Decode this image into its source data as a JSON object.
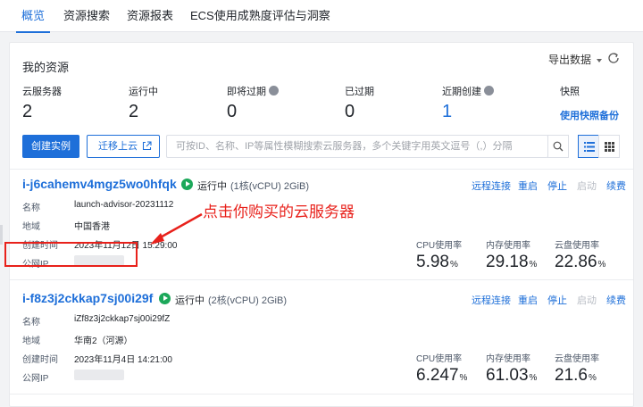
{
  "tabs": [
    {
      "label": "概览"
    },
    {
      "label": "资源搜索"
    },
    {
      "label": "资源报表"
    },
    {
      "label": "ECS使用成熟度评估与洞察"
    }
  ],
  "panel": {
    "title": "我的资源",
    "export_label": "导出数据"
  },
  "stats": [
    {
      "label": "云服务器",
      "value": "2"
    },
    {
      "label": "运行中",
      "value": "2"
    },
    {
      "label": "即将过期",
      "value": "0"
    },
    {
      "label": "已过期",
      "value": "0"
    },
    {
      "label": "近期创建",
      "value": "1"
    },
    {
      "label": "快照",
      "link": "使用快照备份"
    }
  ],
  "toolbar": {
    "create_label": "创建实例",
    "migrate_label": "迁移上云",
    "search_placeholder": "可按ID、名称、IP等属性模糊搜索云服务器，多个关键字用英文逗号（,）分隔"
  },
  "instances": [
    {
      "id": "i-j6cahemv4mgz5wo0hfqk",
      "status": "运行中",
      "spec": "(1核(vCPU) 2GiB)",
      "actions": [
        "远程连接",
        "重启",
        "停止",
        "启动",
        "续费"
      ],
      "name_label": "名称",
      "name": "launch-advisor-20231112",
      "region_label": "地域",
      "region": "中国香港",
      "created_label": "创建时间",
      "created": "2023年11月12日 15:29:00",
      "ip_label": "公网IP",
      "cpu_label": "CPU使用率",
      "cpu": "5.98",
      "mem_label": "内存使用率",
      "mem": "29.18",
      "disk_label": "云盘使用率",
      "disk": "22.86",
      "pct": "%"
    },
    {
      "id": "i-f8z3j2ckkap7sj00i29f",
      "status": "运行中",
      "spec": "(2核(vCPU) 2GiB)",
      "actions": [
        "远程连接",
        "重启",
        "停止",
        "启动",
        "续费"
      ],
      "name_label": "名称",
      "name": "iZf8z3j2ckkap7sj00i29fZ",
      "region_label": "地域",
      "region": "华南2（河源）",
      "created_label": "创建时间",
      "created": "2023年11月4日 14:21:00",
      "ip_label": "公网IP",
      "cpu_label": "CPU使用率",
      "cpu": "6.247",
      "mem_label": "内存使用率",
      "mem": "61.03",
      "disk_label": "云盘使用率",
      "disk": "21.6",
      "pct": "%"
    }
  ],
  "annotation": "点击你购买的云服务器",
  "colors": {
    "accent": "#1e6fd9",
    "running": "#1ca85a",
    "annotation": "#e8211b"
  }
}
